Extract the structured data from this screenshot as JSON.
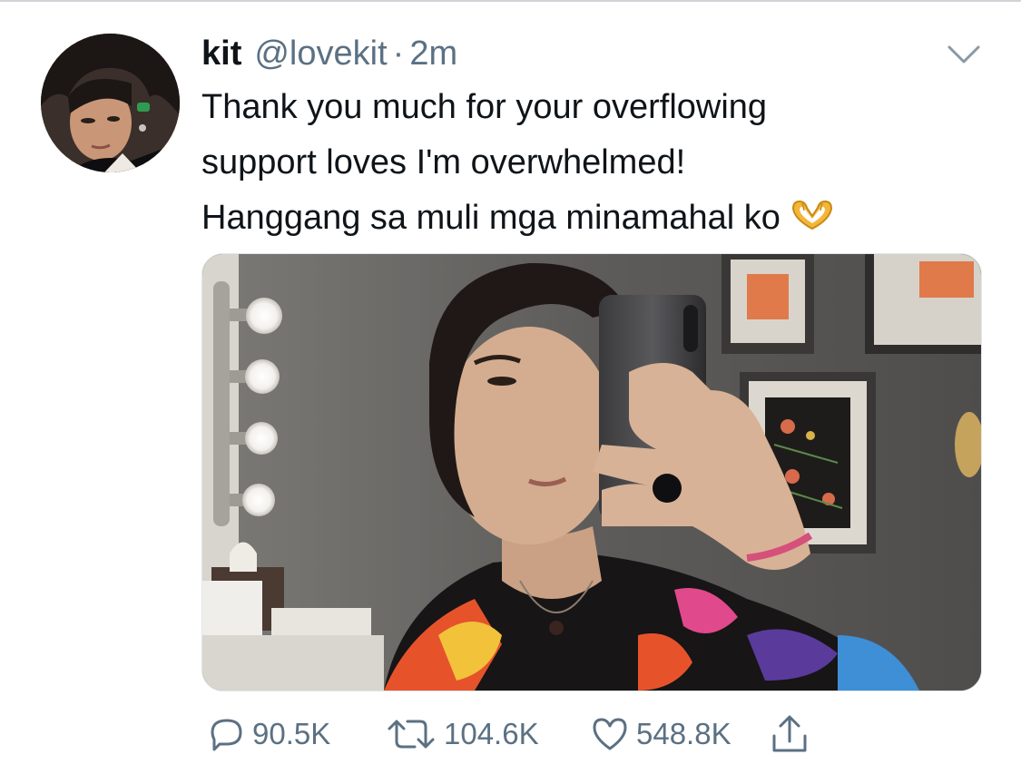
{
  "tweet": {
    "display_name": "kit",
    "handle": "@lovekit",
    "separator": "·",
    "time": "2m",
    "text_lines": [
      "Thank you much for your overflowing",
      "support loves I'm overwhelmed!",
      "Hanggang sa muli mga minamahal ko"
    ],
    "emoji": "heart-hands-emoji",
    "avatar": "profile-photo",
    "media": "mirror-selfie-photo"
  },
  "actions": {
    "reply": {
      "icon": "reply-icon",
      "count": "90.5K"
    },
    "retweet": {
      "icon": "retweet-icon",
      "count": "104.6K"
    },
    "like": {
      "icon": "heart-icon",
      "count": "548.8K"
    },
    "share": {
      "icon": "share-icon"
    }
  },
  "colors": {
    "primary_text": "#0f1419",
    "secondary_text": "#5b7083",
    "divider": "#d0d4d8"
  }
}
